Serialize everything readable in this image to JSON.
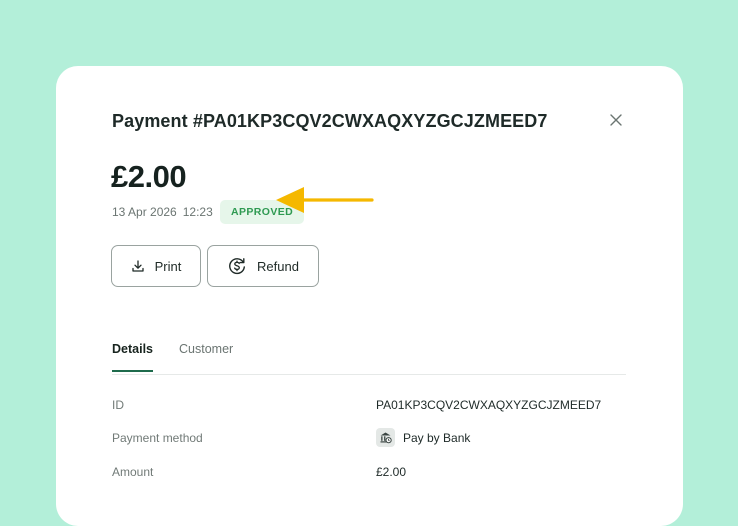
{
  "payment": {
    "title": "Payment #PA01KP3CQV2CWXAQXYZGCJZMEED7",
    "amount": "£2.00",
    "date": "13 Apr 2026",
    "time": "12:23",
    "status": "APPROVED"
  },
  "actions": {
    "print_label": "Print",
    "refund_label": "Refund"
  },
  "tabs": [
    {
      "label": "Details",
      "active": true
    },
    {
      "label": "Customer",
      "active": false
    }
  ],
  "details": {
    "id_label": "ID",
    "id_value": "PA01KP3CQV2CWXAQXYZGCJZMEED7",
    "method_label": "Payment method",
    "method_value": "Pay by Bank",
    "amount_label": "Amount",
    "amount_value": "£2.00"
  },
  "colors": {
    "background": "#b3efd9",
    "status_bg": "#e6f6ea",
    "status_text": "#2f9a52",
    "arrow": "#f5b800",
    "tab_underline": "#1e6b4c"
  },
  "icons": {
    "close": "close-icon",
    "print": "download-icon",
    "refund": "refund-dollar-icon",
    "method": "bank-icon",
    "annotation": "arrow-left-icon"
  }
}
